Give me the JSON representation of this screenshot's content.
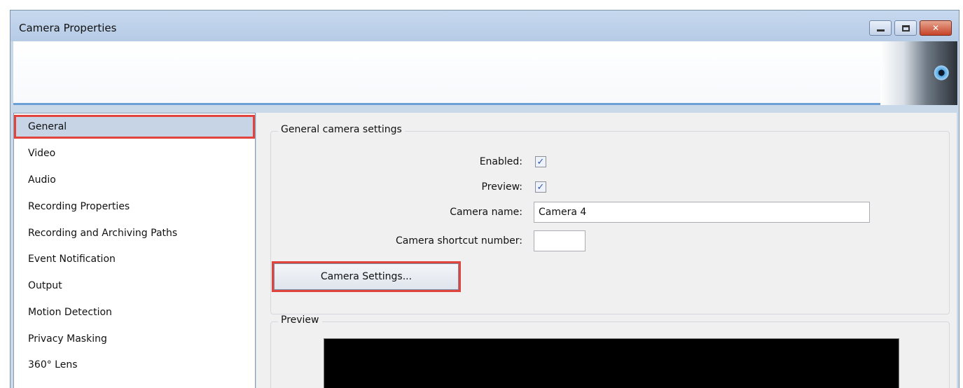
{
  "window": {
    "title": "Camera Properties",
    "controls": [
      "minimize",
      "maximize",
      "close"
    ],
    "close_glyph": "✕"
  },
  "nav": {
    "items": [
      {
        "label": "General",
        "selected": true
      },
      {
        "label": "Video"
      },
      {
        "label": "Audio"
      },
      {
        "label": "Recording Properties"
      },
      {
        "label": "Recording and Archiving Paths"
      },
      {
        "label": "Event Notification"
      },
      {
        "label": "Output"
      },
      {
        "label": "Motion Detection"
      },
      {
        "label": "Privacy Masking"
      },
      {
        "label": "360° Lens"
      }
    ]
  },
  "general": {
    "group_title": "General camera settings",
    "enabled_label": "Enabled:",
    "enabled_checked": true,
    "preview_label": "Preview:",
    "preview_checked": true,
    "camera_name_label": "Camera name:",
    "camera_name_value": "Camera 4",
    "shortcut_label": "Camera shortcut number:",
    "shortcut_value": "",
    "camera_settings_button": "Camera Settings..."
  },
  "preview": {
    "group_title": "Preview"
  },
  "icons": {
    "checkmark": "✓"
  },
  "colors": {
    "highlight": "#e0443d",
    "selected_bg": "#c6d4e6",
    "banner_accent": "#6b9fd6"
  }
}
